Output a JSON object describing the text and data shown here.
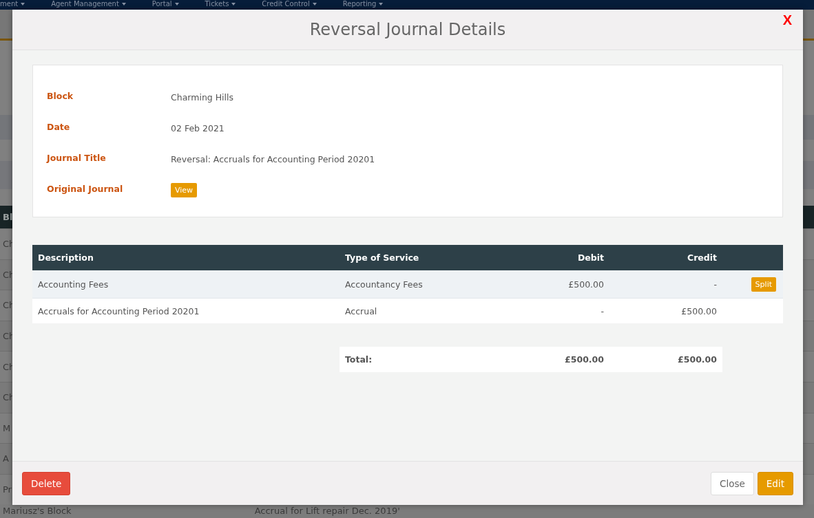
{
  "background": {
    "nav": [
      "ment",
      "Agent Management",
      "Portal",
      "Tickets",
      "Credit Control",
      "Reporting"
    ],
    "table_header": "Bl",
    "rows": [
      "Ch",
      "Ch",
      "Ch",
      "Ch",
      "Ch",
      "Ch",
      "M",
      "A",
      "Pr"
    ],
    "last_row": {
      "block": "Mariusz's Block",
      "title": "Accrual for Lift repair Dec. 2019'"
    }
  },
  "modal": {
    "title": "Reversal Journal Details",
    "close_icon": "X",
    "details": [
      {
        "label": "Block",
        "kind": "text",
        "value": "Charming Hills"
      },
      {
        "label": "Date",
        "kind": "text",
        "value": "02 Feb 2021"
      },
      {
        "label": "Journal Title",
        "kind": "text",
        "value": "Reversal: Accruals for Accounting Period 20201"
      },
      {
        "label": "Original Journal",
        "kind": "button",
        "value": "View"
      }
    ],
    "table": {
      "columns": [
        "Description",
        "Type of Service",
        "Debit",
        "Credit"
      ],
      "rows": [
        {
          "description": "Accounting Fees",
          "type": "Accountancy Fees",
          "debit": "£500.00",
          "credit": "-",
          "action": "Split"
        },
        {
          "description": "Accruals for Accounting Period 20201",
          "type": "Accrual",
          "debit": "-",
          "credit": "£500.00"
        }
      ],
      "total": {
        "label": "Total:",
        "debit": "£500.00",
        "credit": "£500.00"
      }
    },
    "buttons": {
      "delete": "Delete",
      "close": "Close",
      "edit": "Edit"
    }
  }
}
